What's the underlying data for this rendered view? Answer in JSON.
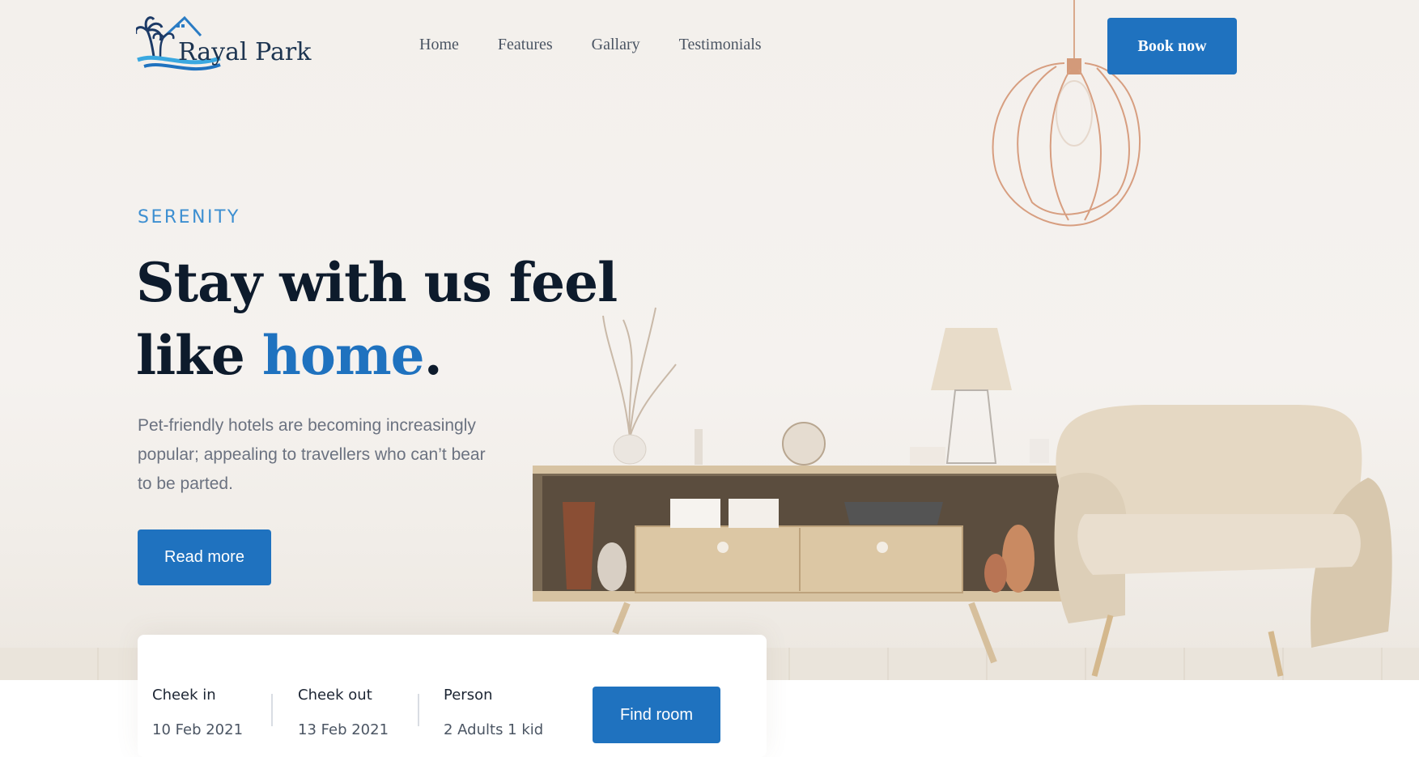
{
  "brand": {
    "name": "Rayal Park"
  },
  "nav": {
    "items": [
      {
        "label": "Home"
      },
      {
        "label": "Features"
      },
      {
        "label": "Gallary"
      },
      {
        "label": "Testimonials"
      }
    ],
    "cta_label": "Book now"
  },
  "hero": {
    "eyebrow": "SERENITY",
    "headline_line1": "Stay with us feel",
    "headline_line2_prefix": "like ",
    "headline_accent": "home",
    "headline_suffix": ".",
    "description": "Pet-friendly hotels are becoming increasingly popular; appealing to travellers who can’t bear to be parted.",
    "read_more_label": "Read more"
  },
  "booking": {
    "check_in": {
      "label": "Cheek in",
      "value": "10 Feb 2021"
    },
    "check_out": {
      "label": "Cheek out",
      "value": "13 Feb 2021"
    },
    "person": {
      "label": "Person",
      "value": "2 Adults 1 kid"
    },
    "find_label": "Find room"
  },
  "colors": {
    "accent": "#1f72bf",
    "eyebrow": "#3d8fd1",
    "heading": "#0d1b2c",
    "body_text": "#6b7280"
  }
}
